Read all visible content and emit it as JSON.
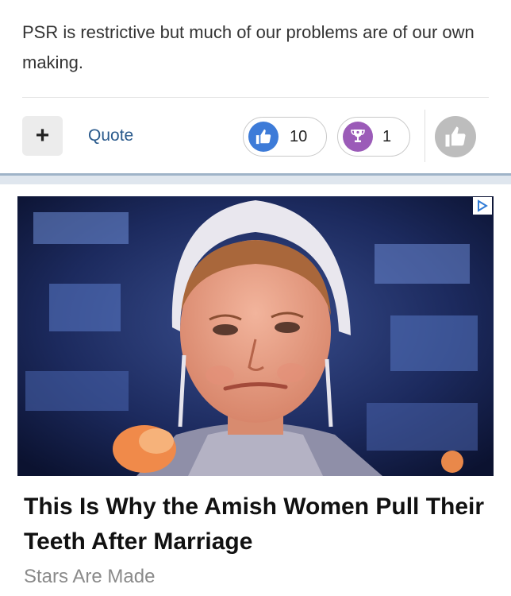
{
  "post": {
    "text": "PSR is restrictive but much of our problems are of our own making."
  },
  "actions": {
    "plus_label": "+",
    "quote_label": "Quote"
  },
  "reactions": {
    "like_count": "10",
    "cup_count": "1"
  },
  "ad": {
    "headline": "This Is Why the Amish Women Pull Their Teeth After Marriage",
    "source": "Stars Are Made"
  },
  "colors": {
    "like_blue": "#3d7bd8",
    "cup_purple": "#9b5bb8",
    "quote_link": "#2a5a8c",
    "ad_choice": "#2f7bd6"
  },
  "icons": [
    "plus-icon",
    "thumbs-up-icon",
    "trophy-icon",
    "thumbs-up-icon",
    "ad-choices-icon"
  ]
}
